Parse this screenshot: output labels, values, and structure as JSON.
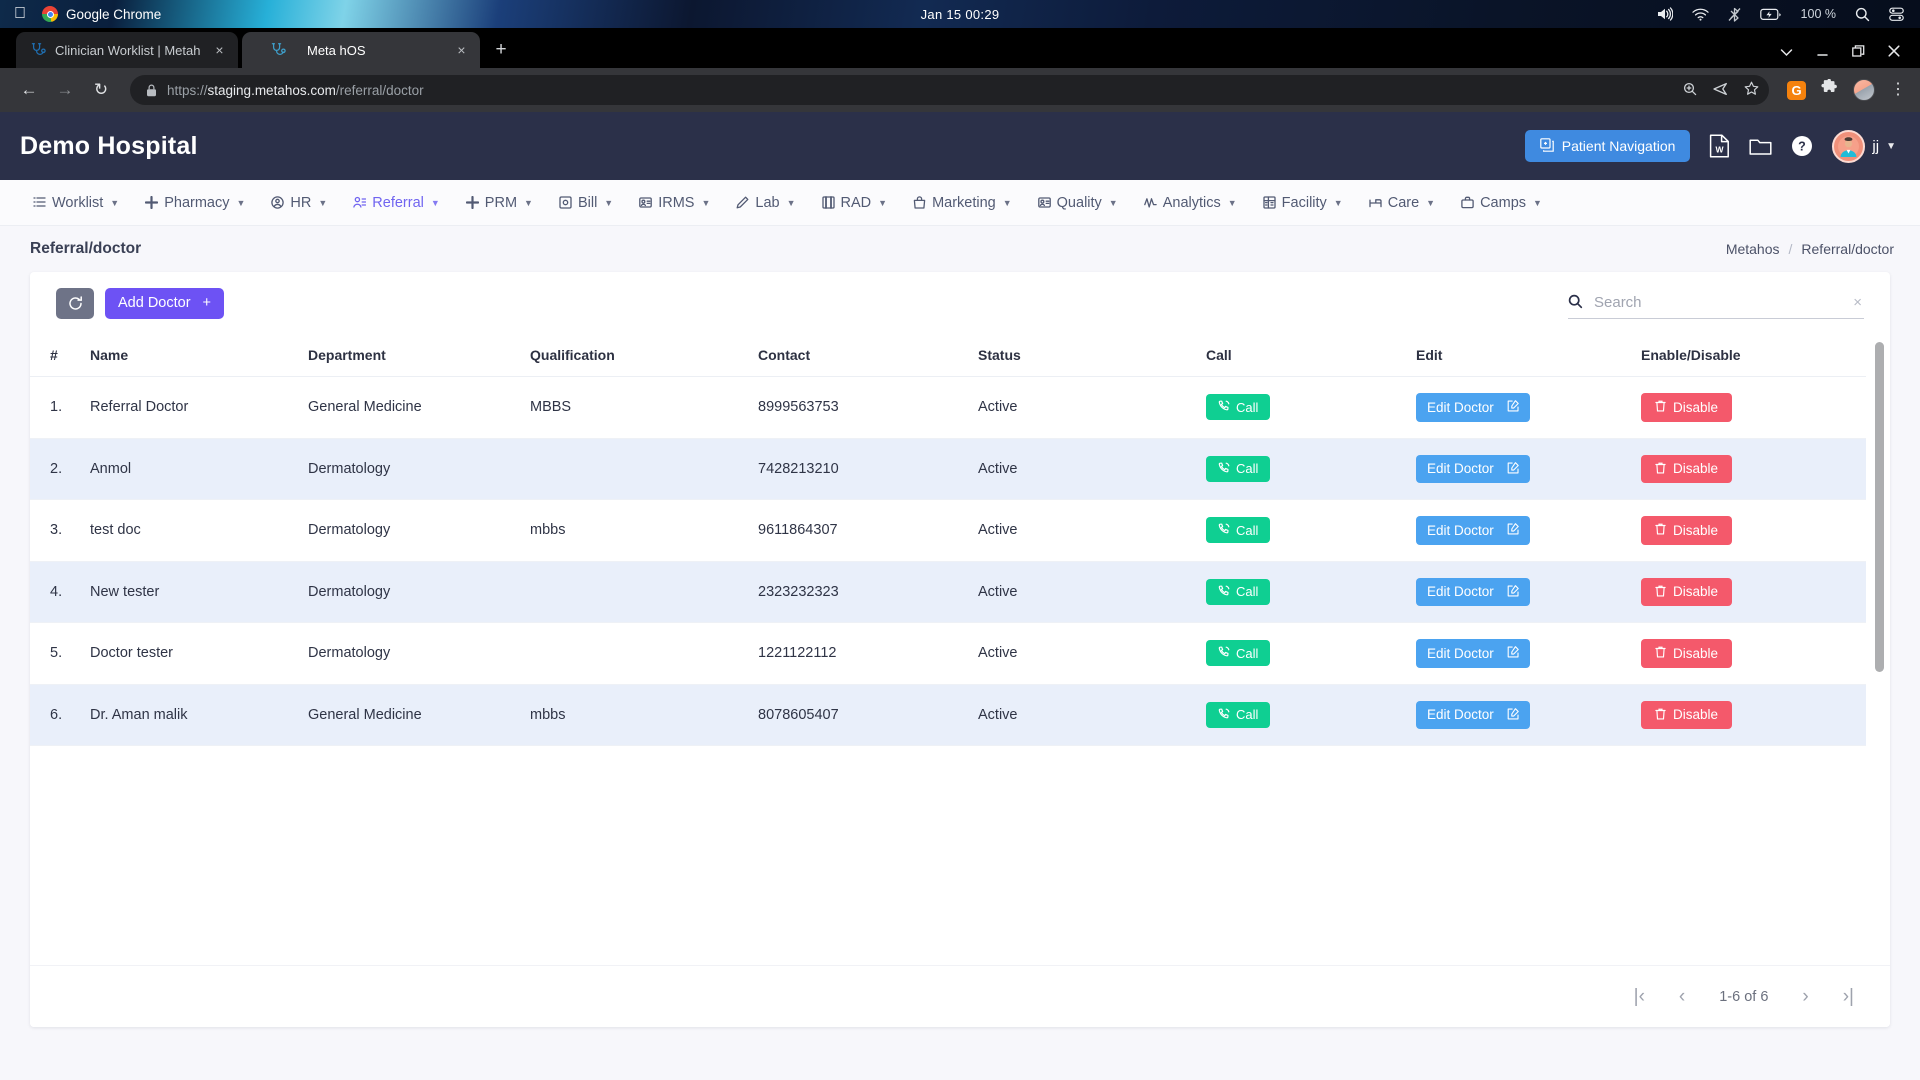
{
  "macos": {
    "apple_logo": "apple-logo",
    "app_name": "Google Chrome",
    "clock": "Jan 15  00:29",
    "battery_percent": "100 %",
    "status_icons": [
      "volume-icon",
      "wifi-icon",
      "bluetooth-off-icon",
      "battery-icon",
      "spotlight-search-icon",
      "control-center-icon"
    ]
  },
  "browser": {
    "tabs": [
      {
        "title": "Clinician Worklist | Metah",
        "favicon": "stethoscope-icon",
        "active": false
      },
      {
        "title": "Meta hOS",
        "favicon": "stethoscope-icon",
        "active": true
      }
    ],
    "new_tab_label": "+",
    "window_controls": [
      "chevron-down",
      "minimize",
      "maximize",
      "close"
    ],
    "back_label": "←",
    "forward_label": "→",
    "reload_label": "↻",
    "url_scheme": "https://",
    "url_host": "staging.metahos.com",
    "url_path": "/referral/doctor",
    "omnibox_actions": [
      "zoom-icon",
      "share-icon",
      "bookmark-star-icon"
    ],
    "extensions": [
      "grammarly-icon",
      "puzzle-extensions-icon",
      "profile-avatar-icon",
      "chrome-menu-icon"
    ],
    "grammarly_letter": "G"
  },
  "app_header": {
    "brand": "Demo Hospital",
    "patient_navigation_label": "Patient Navigation",
    "icons": [
      "word-document-icon",
      "folder-icon",
      "help-circle-icon"
    ],
    "user_initials": "jj"
  },
  "nav": {
    "items": [
      {
        "label": "Worklist",
        "icon": "list-icon",
        "active": false
      },
      {
        "label": "Pharmacy",
        "icon": "plus-icon",
        "active": false
      },
      {
        "label": "HR",
        "icon": "user-circle-icon",
        "active": false
      },
      {
        "label": "Referral",
        "icon": "users-icon",
        "active": true
      },
      {
        "label": "PRM",
        "icon": "plus-icon",
        "active": false
      },
      {
        "label": "Bill",
        "icon": "receipt-icon",
        "active": false
      },
      {
        "label": "IRMS",
        "icon": "id-card-icon",
        "active": false
      },
      {
        "label": "Lab",
        "icon": "pen-icon",
        "active": false
      },
      {
        "label": "RAD",
        "icon": "film-icon",
        "active": false
      },
      {
        "label": "Marketing",
        "icon": "bag-icon",
        "active": false
      },
      {
        "label": "Quality",
        "icon": "badge-icon",
        "active": false
      },
      {
        "label": "Analytics",
        "icon": "pulse-icon",
        "active": false
      },
      {
        "label": "Facility",
        "icon": "building-icon",
        "active": false
      },
      {
        "label": "Care",
        "icon": "bed-icon",
        "active": false
      },
      {
        "label": "Camps",
        "icon": "briefcase-icon",
        "active": false
      }
    ]
  },
  "page": {
    "title": "Referral/doctor",
    "breadcrumb_root": "Metahos",
    "breadcrumb_sep": "/",
    "breadcrumb_current": "Referral/doctor"
  },
  "toolbar": {
    "refresh_icon": "refresh-icon",
    "add_doctor_label": "Add Doctor",
    "add_doctor_plus": "+",
    "search_placeholder": "Search",
    "search_value": "",
    "search_clear": "×"
  },
  "table": {
    "columns": [
      "#",
      "Name",
      "Department",
      "Qualification",
      "Contact",
      "Status",
      "Call",
      "Edit",
      "Enable/Disable"
    ],
    "rows": [
      {
        "idx": "1.",
        "name": "Referral Doctor",
        "department": "General Medicine",
        "qualification": "MBBS",
        "contact": "8999563753",
        "status": "Active"
      },
      {
        "idx": "2.",
        "name": "Anmol",
        "department": "Dermatology",
        "qualification": "",
        "contact": "7428213210",
        "status": "Active"
      },
      {
        "idx": "3.",
        "name": "test doc",
        "department": "Dermatology",
        "qualification": "mbbs",
        "contact": "9611864307",
        "status": "Active"
      },
      {
        "idx": "4.",
        "name": "New tester",
        "department": "Dermatology",
        "qualification": "",
        "contact": "2323232323",
        "status": "Active"
      },
      {
        "idx": "5.",
        "name": "Doctor tester",
        "department": "Dermatology",
        "qualification": "",
        "contact": "1221122112",
        "status": "Active"
      },
      {
        "idx": "6.",
        "name": "Dr. Aman malik",
        "department": "General Medicine",
        "qualification": "mbbs",
        "contact": "8078605407",
        "status": "Active"
      }
    ],
    "call_label": "Call",
    "edit_label": "Edit Doctor",
    "disable_label": "Disable"
  },
  "pagination": {
    "first_label": "|‹",
    "prev_label": "‹",
    "range_label": "1-6 of 6",
    "next_label": "›",
    "last_label": "›|"
  },
  "colors": {
    "accent_purple": "#6d52f4",
    "header_navy": "#2b3049",
    "call_green": "#0fcf92",
    "edit_blue": "#4ba3f0",
    "disable_red": "#f4596b",
    "patient_nav_blue": "#3f8ae0",
    "row_alt": "#e9effa"
  }
}
